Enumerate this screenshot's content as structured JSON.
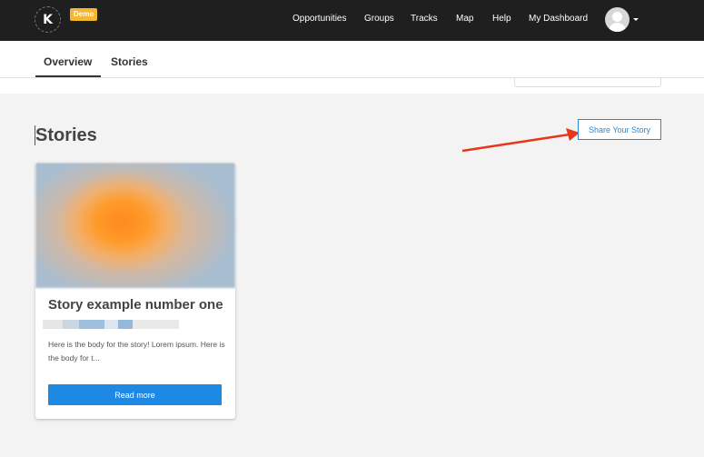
{
  "header": {
    "logo_letter": "K",
    "demo_badge": "Demo",
    "nav": [
      "Opportunities",
      "Groups",
      "Tracks",
      "Map",
      "Help",
      "My Dashboard"
    ],
    "avatar_icon": "user-avatar-icon",
    "menu_caret_icon": "chevron-down-icon"
  },
  "tabs": [
    "Overview",
    "Stories"
  ],
  "active_tab": "Overview",
  "page": {
    "title": "Stories",
    "share_button": "Share Your Story"
  },
  "annotation": {
    "arrow_color": "#e8361c"
  },
  "stories": [
    {
      "title": "Story example number one",
      "body": "Here is the body for the story! Lorem ipsum. Here is the body for t...",
      "read_more": "Read more"
    }
  ],
  "colors": {
    "header_bg": "#1f1f1f",
    "accent": "#1e88e5",
    "badge": "#f5b731",
    "page_bg": "#f3f3f3"
  }
}
